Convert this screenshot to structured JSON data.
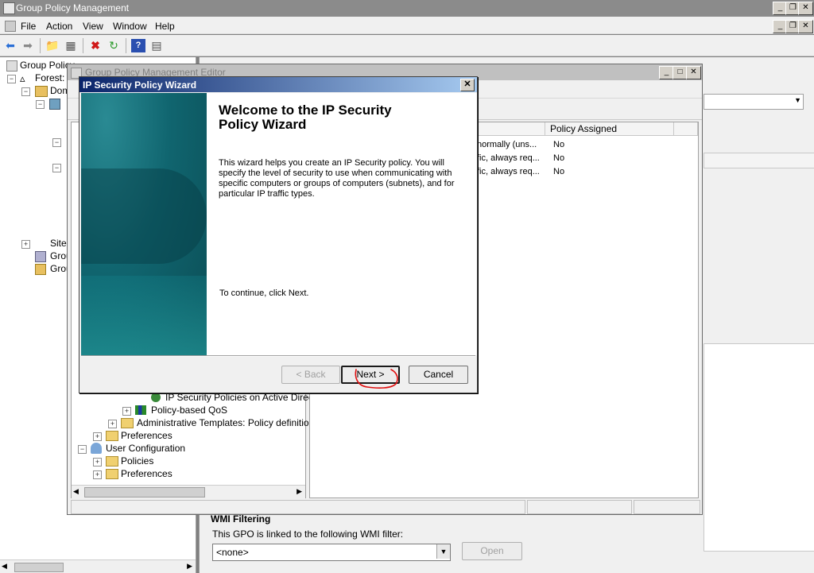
{
  "main": {
    "title": "Group Policy Management",
    "menu": [
      "File",
      "Action",
      "View",
      "Window",
      "Help"
    ]
  },
  "left_tree": {
    "items": [
      {
        "label": "Group Policy"
      },
      {
        "label": "Forest:"
      },
      {
        "label": "Dom"
      },
      {
        "label": "Sites"
      },
      {
        "label": "Grou"
      },
      {
        "label": "Grou"
      }
    ]
  },
  "gpme": {
    "title": "Group Policy Management Editor",
    "tree_items": [
      {
        "label": "IP Security Policies on Active Directo"
      },
      {
        "label": "Policy-based QoS"
      },
      {
        "label": "Administrative Templates: Policy definitions ("
      },
      {
        "label": "Preferences"
      },
      {
        "label": "User Configuration"
      },
      {
        "label": "Policies"
      },
      {
        "label": "Preferences"
      }
    ],
    "list": {
      "column_policy_assigned": "Policy Assigned",
      "rows": [
        {
          "desc": "normally (uns...",
          "assigned": "No"
        },
        {
          "desc": "fic, always req...",
          "assigned": "No"
        },
        {
          "desc": "fic, always req...",
          "assigned": "No"
        }
      ]
    }
  },
  "wizard": {
    "title": "IP Security Policy Wizard",
    "heading": "Welcome to the IP Security Policy Wizard",
    "description": "This wizard helps you create an IP Security policy. You will specify the level of security to use when communicating with specific computers or groups of computers (subnets), and for particular IP traffic types.",
    "continue_text": "To continue, click Next.",
    "back_label": "< Back",
    "next_label": "Next >",
    "cancel_label": "Cancel",
    "close_glyph": "✕"
  },
  "wmi": {
    "heading": "WMI Filtering",
    "description": "This GPO is linked to the following WMI filter:",
    "selected": "<none>",
    "open_label": "Open"
  },
  "colors": {
    "annotation": "#e01010",
    "wizard_title_start": "#0a246a",
    "wizard_side": "#10656f"
  }
}
